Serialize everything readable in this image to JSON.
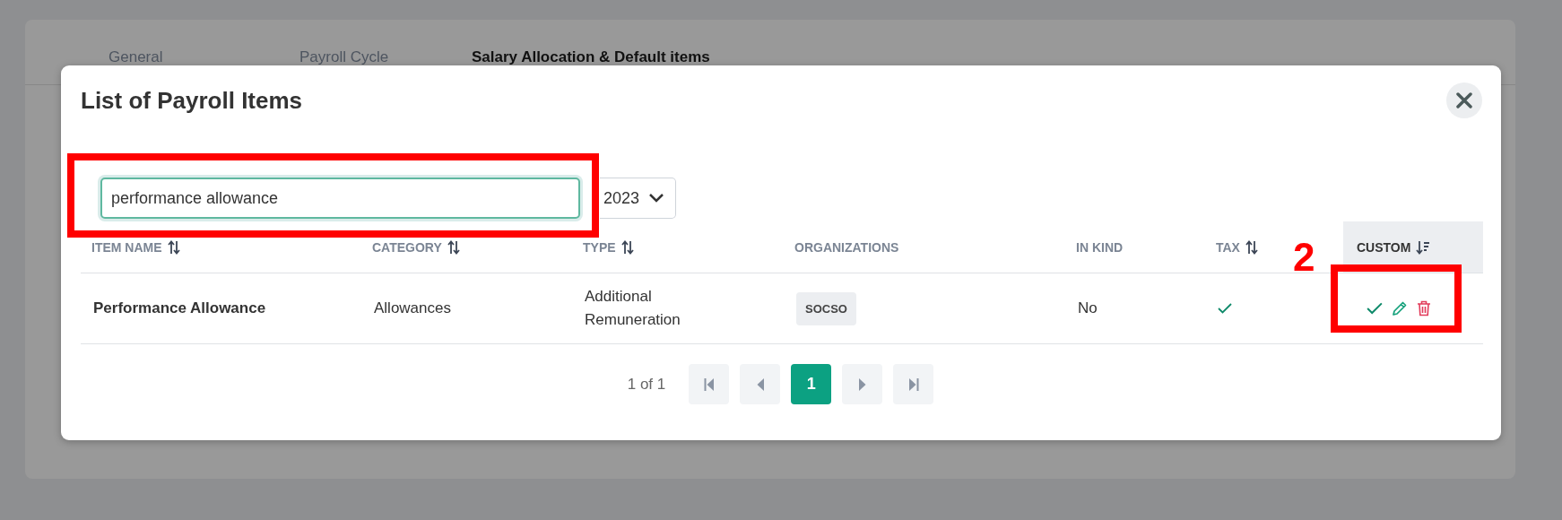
{
  "background": {
    "tabs": [
      {
        "label": "General",
        "selected": false
      },
      {
        "label": "Payroll Cycle",
        "selected": false
      },
      {
        "label": "Salary Allocation & Default items",
        "selected": true
      }
    ]
  },
  "modal": {
    "title": "List of Payroll Items",
    "search": {
      "value": "performance allowance"
    },
    "year_select": {
      "value": "2023"
    },
    "table": {
      "columns": [
        {
          "label": "ITEM NAME",
          "sortable": true,
          "sorted": false
        },
        {
          "label": "CATEGORY",
          "sortable": true,
          "sorted": false
        },
        {
          "label": "TYPE",
          "sortable": true,
          "sorted": false
        },
        {
          "label": "ORGANIZATIONS",
          "sortable": false,
          "sorted": false
        },
        {
          "label": "IN KIND",
          "sortable": false,
          "sorted": false
        },
        {
          "label": "TAX",
          "sortable": true,
          "sorted": false
        },
        {
          "label": "CUSTOM",
          "sortable": true,
          "sorted": true
        }
      ],
      "rows": [
        {
          "item_name": "Performance Allowance",
          "category": "Allowances",
          "type": "Additional Remuneration",
          "organizations": [
            "SOCSO"
          ],
          "in_kind": "No",
          "tax": true,
          "custom": true
        }
      ]
    },
    "pagination": {
      "summary": "1 of 1",
      "pages": [
        {
          "label": "1",
          "selected": true
        }
      ]
    }
  },
  "annotations": [
    {
      "kind": "box"
    },
    {
      "kind": "box",
      "label": "2"
    }
  ]
}
